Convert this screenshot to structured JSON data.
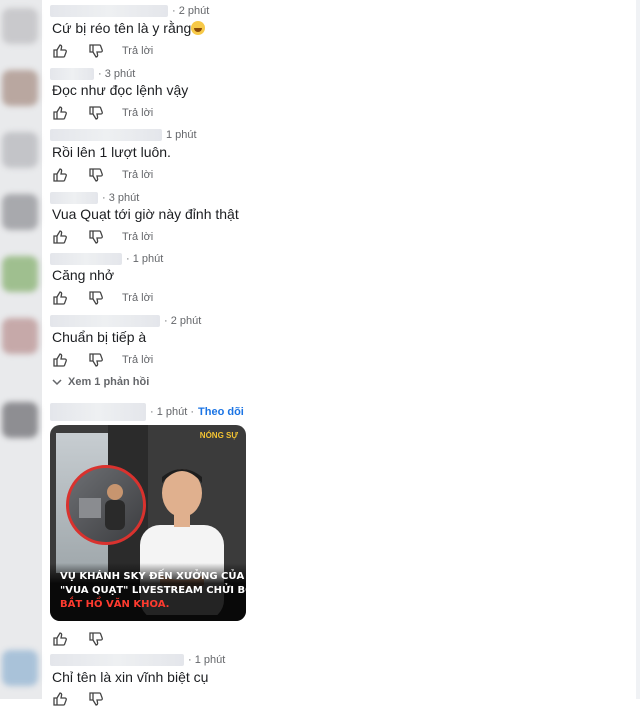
{
  "comments": [
    {
      "time": "· 2 phút",
      "text": "Cứ bị réo tên là y rằng",
      "reply": "Trả lời"
    },
    {
      "time": "· 3 phút",
      "text": "Đọc như đọc lệnh vậy",
      "reply": "Trả lời"
    },
    {
      "time": "1 phút",
      "text": "Rồi lên 1 lượt luôn.",
      "reply": "Trả lời"
    },
    {
      "time": "· 3 phút",
      "text": "Vua Quạt tới giờ này đỉnh thật",
      "reply": "Trả lời"
    },
    {
      "time": "· 1 phút",
      "text": "Căng nhở",
      "reply": "Trả lời"
    },
    {
      "time": "· 2 phút",
      "text": "Chuẩn bị tiếp à",
      "reply": "Trả lời"
    }
  ],
  "view_replies": "Xem 1 phản hồi",
  "video_comment": {
    "time": "· 1 phút ·",
    "follow": "Theo dõi",
    "brand": "NÓNG SỰ",
    "caption_lines": [
      "VỤ KHÁNH SKY ĐẾN XƯỞNG CỦA",
      "\"VUA QUẠT\" LIVESTREAM CHỬI BỚI:",
      "BẮT HỒ VĂN KHOA."
    ]
  },
  "last_comment": {
    "time": "· 1 phút",
    "text": "Chỉ tên là xin vĩnh biệt cụ"
  },
  "colors": {
    "link": "#1b74e4",
    "meta": "#65676b",
    "text": "#1c1e21"
  },
  "icons": [
    "like-icon",
    "dislike-icon",
    "chevron-down-icon"
  ]
}
